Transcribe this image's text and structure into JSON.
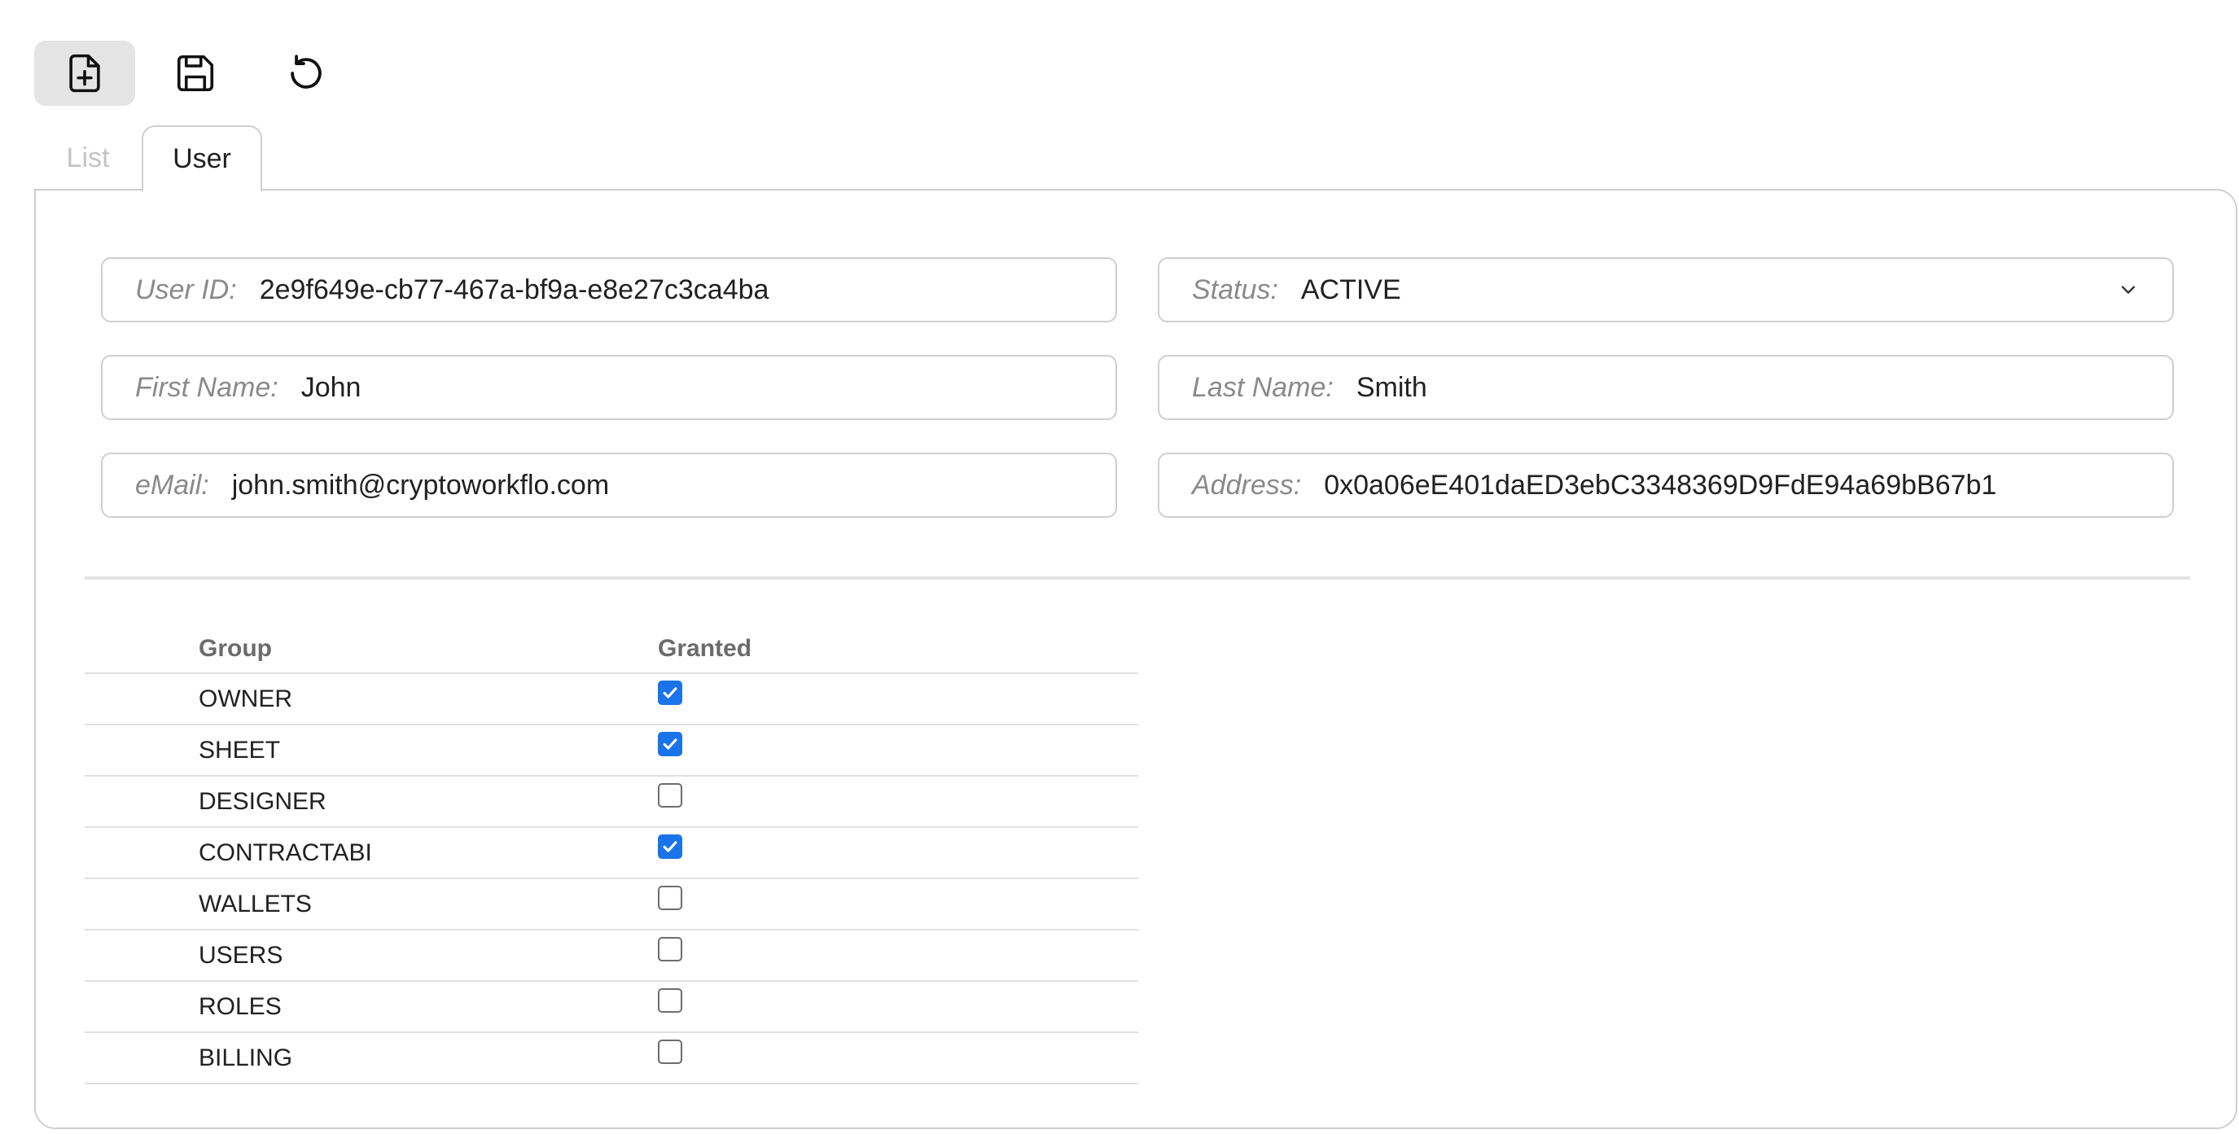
{
  "toolbar": {
    "new_icon": "file-plus-icon",
    "save_icon": "floppy-disk-icon",
    "reload_icon": "reload-icon"
  },
  "tabs": [
    {
      "label": "List",
      "active": false
    },
    {
      "label": "User",
      "active": true
    }
  ],
  "form": {
    "user_id": {
      "label": "User ID:",
      "value": "2e9f649e-cb77-467a-bf9a-e8e27c3ca4ba"
    },
    "status": {
      "label": "Status:",
      "value": "ACTIVE"
    },
    "first_name": {
      "label": "First Name:",
      "value": "John"
    },
    "last_name": {
      "label": "Last Name:",
      "value": "Smith"
    },
    "email": {
      "label": "eMail:",
      "value": "john.smith@cryptoworkflo.com"
    },
    "address": {
      "label": "Address:",
      "value": "0x0a06eE401daED3ebC3348369D9FdE94a69bB67b1"
    }
  },
  "groups_table": {
    "headers": {
      "group": "Group",
      "granted": "Granted"
    },
    "rows": [
      {
        "group": "OWNER",
        "granted": true
      },
      {
        "group": "SHEET",
        "granted": true
      },
      {
        "group": "DESIGNER",
        "granted": false
      },
      {
        "group": "CONTRACTABI",
        "granted": true
      },
      {
        "group": "WALLETS",
        "granted": false
      },
      {
        "group": "USERS",
        "granted": false
      },
      {
        "group": "ROLES",
        "granted": false
      },
      {
        "group": "BILLING",
        "granted": false
      }
    ]
  },
  "colors": {
    "accent": "#1a73e8",
    "border": "#cfcfcf",
    "label": "#8a8a8a"
  }
}
